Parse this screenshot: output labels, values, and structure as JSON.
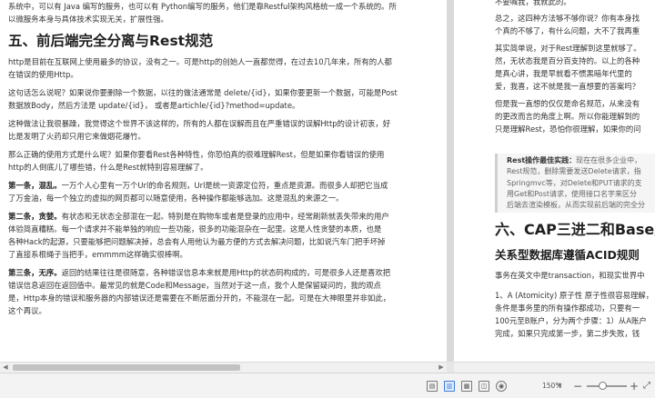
{
  "left_page": {
    "intro_line1": "系统中，可以有 Java 编写的服务，也可以有 Python编写的服务，他们是靠Restful架构风格统一成一个系统的。所",
    "intro_line2": "以微服务本身与具体技术实现无关，扩展性强。",
    "heading5": "五、前后端完全分离与Rest规范",
    "p1_line1": "http是目前在互联网上使用最多的协议，没有之一。可是http的创始人一直都觉得，在过去10几年来，所有的人都",
    "p1_line2": "在错误的使用Http。",
    "p2_line1": "这句话怎么说呢？如果说你要删除一个数据，以往的做法通常是 delete/{id}，如果你要更新一个数据，可能是Post",
    "p2_line2": "数据放Body，然后方法是 update/{id}， 或者是artichle/{id}?method=update。",
    "p3_line1": "这种做法让我很暴躁，我觉得这个世界不该这样的，所有的人都在误解而且在严重错误的误解Http的设计初衷，好",
    "p3_line2": "比是发明了火药却只用它来做烟花爆竹。",
    "p4_line1": "那么正确的使用方式是什么呢？如果你要看Rest各种特性，你恐怕真的很难理解Rest，但是如果你看错误的使用",
    "p4_line2": "http的人倒底儿了哪些错，什么是Rest就特别容易理解了。",
    "p5_title": "第一条，混乱。",
    "p5_line1": "一万个人心里有一万个Url的命名规则，Url是统一资源定位符，重点是资源。而很多人却把它当成",
    "p5_line2": "了万金油，每一个独立的虚拟的网页都可以随意使用，各种操作都能够选加。这是混乱的来源之一。",
    "p6_title": "第二条，贪婪。",
    "p6_line1": "有状态和无状态全部混在一起。特别是在购物车或者是登录的应用中，经常刷新就丢失带来的用户",
    "p6_line2": "体验简直糟糕。每一个请求并不能单独的响应一些功能，很多的功能混杂在一起里。这是人性贪婪的本质，也是",
    "p6_line3": "各种Hack的起源，只要能够把问题解决掉，总会有人用他认为最方便的方式去解决问题，比如说汽车门把手坏掉",
    "p6_line4": "了直接系根绳子当把手，emmmm这样确实很棒啊。",
    "p7_title": "第三条，无序。",
    "p7_line1": "返回的结果往往是很随意，各种错误信息本来就是用Http的状态码构成的，可是很多人还是喜欢把",
    "p7_line2": "错误信息返回在返回值中。最常见的就是Code和Message，当然对于这一点，我个人是保留疑问的，我的观点",
    "p7_line3": "是，Http本身的错误和服务器的内部错误还是需要在不断层面分开的，不能混在一起。可是在大神眼里并非如此，",
    "p7_line4": "这个再议。"
  },
  "right_page": {
    "top_line": "不要喊我，我就此的。",
    "q_line1": "总之，这四种方法够不够你说？你有本身找",
    "q_line2": "个真的不够了，有什么问题，大不了我再重",
    "r1_line1": "其实简单说，对于Rest理解到这里就够了。",
    "r1_line2": "然，无状态我是百分百支持的。以上的各种",
    "r1_line3": "是真心讲，我是早就看不惯黑暗年代里的",
    "r1_line4": "爱，我喜，这不就是我一直想要的答案吗？",
    "r2_line1": "但是我一直想的仅仅是命名规范，从来没有",
    "r2_line2": "的更改而言的角度上啊。所以你能理解到的",
    "r2_line3": "只是理解Rest，恐怕你很理解，如果你的问",
    "quote_title": "Rest操作最佳实践：",
    "quote_l1": "现在在很多企业中，",
    "quote_l2": "Rest规范，删除需要发送Delete请求，指",
    "quote_l3": "Springmvc等，对Delete和PUT请求的支",
    "quote_l4": "用Get和Post请求，使用接口名字来区分",
    "quote_l5": "后端去渲染模板，从而实现前后端的完全分",
    "heading6": "六、CAP三进二和Base定",
    "subheading": "关系型数据库遵循ACID规则",
    "acid_line": "事务在英文中是transaction，和现实世界中",
    "a1_line1": "1、A (Atomicity) 原子性 原子性很容易理解，",
    "a1_line2": "条件是事务里的所有操作都成功，只要有一",
    "a1_line3": "100元至B账户，分为两个步骤：1）从A账户",
    "a1_line4": "完成，如果只完成第一步，第二步失败，钱"
  },
  "status_bar": {
    "zoom_value": "150%",
    "zoom_minus": "−",
    "zoom_plus": "+",
    "fit_label": "⤢",
    "zoom_level": 0.4
  },
  "icons": [
    "view-mode-icon",
    "page-view-icon",
    "read-mode-icon",
    "web-view-icon",
    "eye-protect-icon"
  ]
}
